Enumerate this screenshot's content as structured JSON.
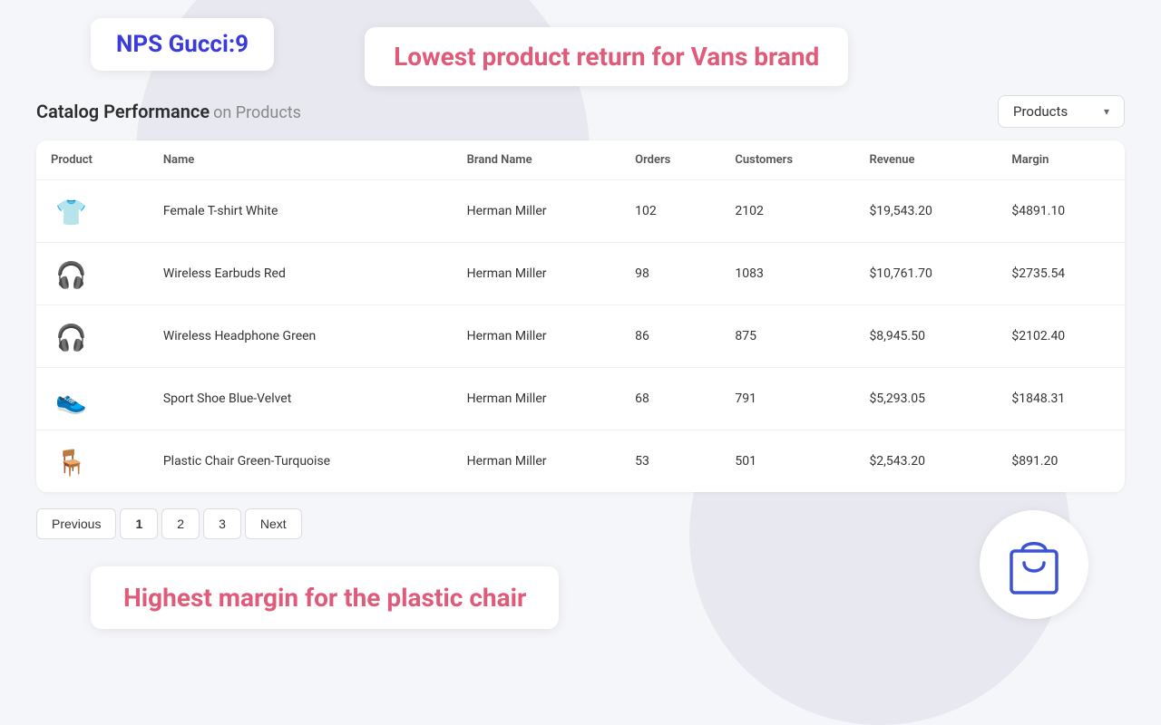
{
  "nps": {
    "label": "NPS Gucci:9"
  },
  "tooltip_top": {
    "text": "Lowest product return for Vans brand"
  },
  "section": {
    "title": "Catalog Performance",
    "subtitle": " on Products",
    "dropdown_label": "Products"
  },
  "table": {
    "columns": [
      "Product",
      "Name",
      "Brand Name",
      "Orders",
      "Customers",
      "Revenue",
      "Margin"
    ],
    "rows": [
      {
        "name": "Female T-shirt White",
        "brand": "Herman Miller",
        "orders": "102",
        "customers": "2102",
        "revenue": "$19,543.20",
        "margin": "$4891.10",
        "icon": "👕"
      },
      {
        "name": "Wireless Earbuds Red",
        "brand": "Herman Miller",
        "orders": "98",
        "customers": "1083",
        "revenue": "$10,761.70",
        "margin": "$2735.54",
        "icon": "🎧"
      },
      {
        "name": "Wireless Headphone  Green",
        "brand": "Herman Miller",
        "orders": "86",
        "customers": "875",
        "revenue": "$8,945.50",
        "margin": "$2102.40",
        "icon": "🎧"
      },
      {
        "name": "Sport Shoe Blue-Velvet",
        "brand": "Herman Miller",
        "orders": "68",
        "customers": "791",
        "revenue": "$5,293.05",
        "margin": "$1848.31",
        "icon": "👟"
      },
      {
        "name": "Plastic Chair Green-Turquoise",
        "brand": "Herman Miller",
        "orders": "53",
        "customers": "501",
        "revenue": "$2,543.20",
        "margin": "$891.20",
        "icon": "🪑"
      }
    ]
  },
  "pagination": {
    "previous_label": "Previous",
    "next_label": "Next",
    "pages": [
      "1",
      "2",
      "3"
    ],
    "active_page": "1"
  },
  "tooltip_bottom": {
    "text": "Highest margin for the plastic chair"
  },
  "icons": {
    "dropdown_arrow": "▾",
    "shopping_bag": "🛍"
  }
}
